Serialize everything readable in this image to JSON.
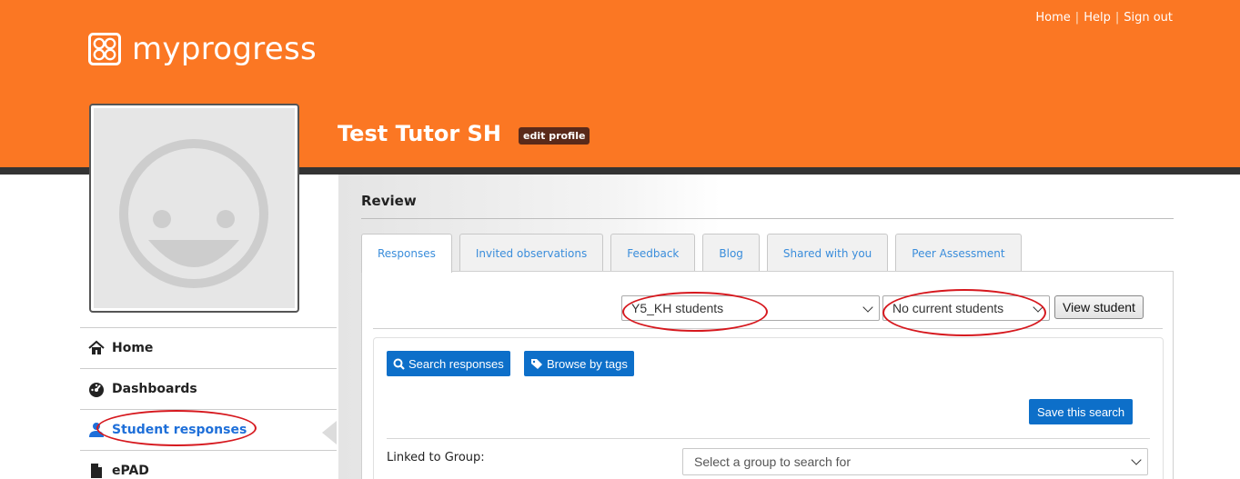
{
  "header": {
    "logo_text": "myprogress",
    "top_links": [
      "Home",
      "Help",
      "Sign out"
    ],
    "profile_name": "Test Tutor SH",
    "edit_profile_label": "edit profile"
  },
  "sidebar": {
    "items": [
      {
        "label": "Home",
        "icon": "home-icon"
      },
      {
        "label": "Dashboards",
        "icon": "dashboard-icon"
      },
      {
        "label": "Student responses",
        "icon": "user-icon"
      },
      {
        "label": "ePAD",
        "icon": "document-icon"
      }
    ]
  },
  "main": {
    "title": "Review",
    "tabs": [
      {
        "label": "Responses",
        "active": true
      },
      {
        "label": "Invited observations",
        "active": false
      },
      {
        "label": "Feedback",
        "active": false
      },
      {
        "label": "Blog",
        "active": false
      },
      {
        "label": "Shared with you",
        "active": false
      },
      {
        "label": "Peer Assessment",
        "active": false
      }
    ],
    "group_select": "Y5_KH students",
    "student_select": "No current students",
    "view_student_label": "View student",
    "search_responses_label": "Search responses",
    "browse_tags_label": "Browse by tags",
    "save_search_label": "Save this search",
    "linked_group_label": "Linked to Group:",
    "linked_group_placeholder": "Select a group to search for"
  },
  "colors": {
    "header_orange": "#fb7723",
    "accent_blue": "#0d6fc9",
    "annotation_red": "#d6181e"
  }
}
